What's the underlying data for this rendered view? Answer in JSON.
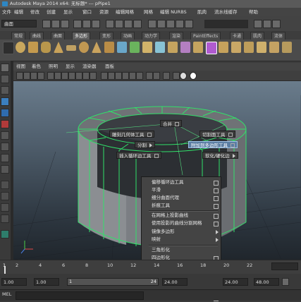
{
  "window": {
    "title": "Autodesk Maya 2014 x64: 无标题* --- pPipe1"
  },
  "menubar": [
    "文件",
    "编辑",
    "修改",
    "创建",
    "显示",
    "窗口",
    "资源",
    "编辑网格",
    "网格",
    "编辑 NURBS",
    "肌肉",
    "流水线缓存",
    "帮助"
  ],
  "statusline": {
    "mode": "曲面"
  },
  "shelf_tabs": {
    "items": [
      "常规",
      "曲线",
      "曲面",
      "多边形",
      "变形",
      "动画",
      "动力学",
      "渲染",
      "PaintEffects",
      "卡通",
      "肌肉",
      "流体"
    ],
    "active_index": 3
  },
  "panel_menu": [
    "视图",
    "着色",
    "照明",
    "显示",
    "渲染器",
    "面板"
  ],
  "hotbox": {
    "merge": "合并",
    "cut_face": "切割面工具",
    "interactive_split": "雕刻几何体工具",
    "split": "分割",
    "add_division": "附加到多边形工具",
    "insert_loop": "插入循环边工具",
    "soften_harden": "软化/硬化边"
  },
  "submenu": {
    "items": [
      "偏移循环边工具",
      "平滑",
      "细分曲面代理",
      "折痕工具",
      "在网格上投影曲线",
      "使用投影的曲线分割网格",
      "镜像多边形",
      "映射",
      "三角形化",
      "四边形化",
      "分离",
      "结合",
      "布尔",
      "减少",
      "清理"
    ]
  },
  "timeslider": {
    "ticks": [
      "2",
      "4",
      "6",
      "8",
      "10",
      "12",
      "14",
      "16",
      "18",
      "20",
      "22"
    ],
    "current": "1"
  },
  "range": {
    "start": "1.00",
    "inner_start": "1",
    "inner_end": "24",
    "end": "24.00",
    "max": "48.00"
  },
  "cmdline": {
    "label": "MEL"
  },
  "colors": {
    "wire": "#31e06a",
    "highlight": "#5b7da3",
    "viewport_top": "#6a7c8c"
  }
}
